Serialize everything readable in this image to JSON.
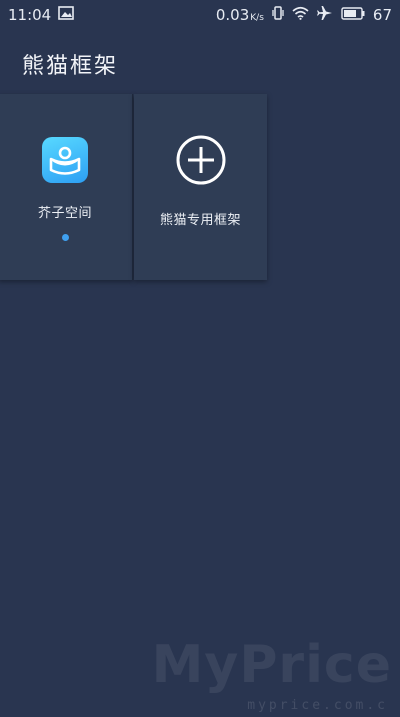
{
  "status_bar": {
    "time": "11:04",
    "net_speed": "0.03",
    "net_speed_unit": "K/s",
    "battery": "67",
    "icons": [
      "image-icon",
      "vibrate-icon",
      "wifi-icon",
      "airplane-icon",
      "battery-icon"
    ]
  },
  "app": {
    "title": "熊猫框架"
  },
  "cards": [
    {
      "label": "芥子空间",
      "icon": "app-icon",
      "running": true
    },
    {
      "label": "熊猫专用框架",
      "icon": "add-circle-icon"
    }
  ],
  "watermark": {
    "brand": "MyPrice",
    "site": "myprice.com.c"
  },
  "colors": {
    "background": "#293550",
    "card": "#2f3d55",
    "accent": "#3fa0f0"
  }
}
